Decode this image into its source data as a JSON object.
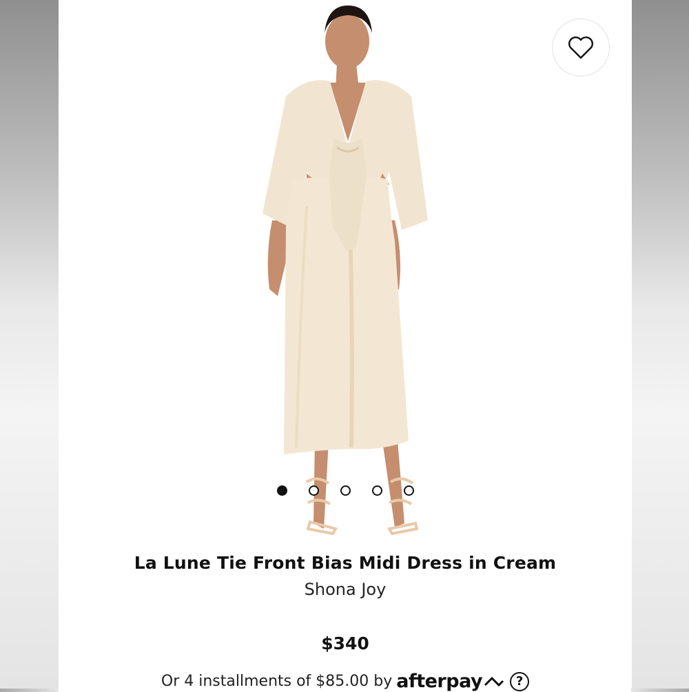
{
  "product": {
    "title": "La Lune Tie Front Bias Midi Dress in Cream",
    "brand": "Shona Joy",
    "price": "$340",
    "image_icon": "product-photo",
    "favorite_icon": "heart-icon"
  },
  "carousel": {
    "count": 5,
    "active_index": 0
  },
  "payment": {
    "installment_text": "Or 4 installments of $85.00 by",
    "provider": "afterpay",
    "help_label": "?"
  },
  "colors": {
    "dress": "#f3e7d3",
    "accent_dark": "#111111"
  }
}
